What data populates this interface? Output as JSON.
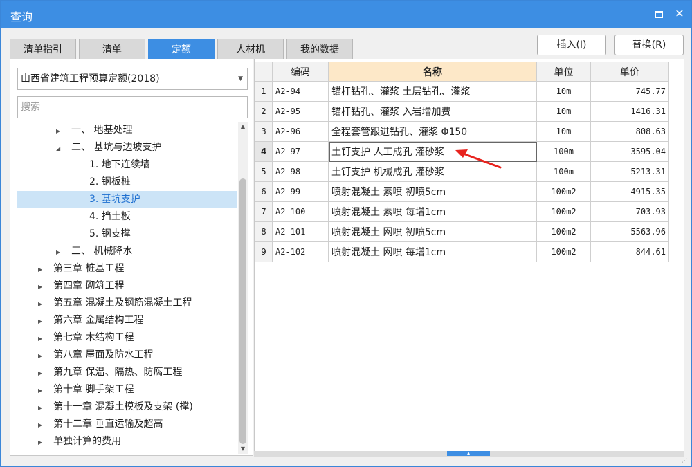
{
  "window": {
    "title": "查询"
  },
  "tabs": [
    {
      "label": "清单指引"
    },
    {
      "label": "清单"
    },
    {
      "label": "定额"
    },
    {
      "label": "人材机"
    },
    {
      "label": "我的数据"
    }
  ],
  "actions": {
    "insert": "插入(I)",
    "replace": "替换(R)"
  },
  "left": {
    "quota_select": "山西省建筑工程预算定额(2018)",
    "search_placeholder": "搜索",
    "tree": [
      {
        "label": "一、 地基处理",
        "arrow": "▶",
        "level": 1
      },
      {
        "label": "二、 基坑与边坡支护",
        "arrow": "◢",
        "level": 1
      },
      {
        "label": "1. 地下连续墙",
        "arrow": "",
        "level": 2
      },
      {
        "label": "2. 钢板桩",
        "arrow": "",
        "level": 2
      },
      {
        "label": "3. 基坑支护",
        "arrow": "",
        "level": 2,
        "selected": true
      },
      {
        "label": "4. 挡土板",
        "arrow": "",
        "level": 2
      },
      {
        "label": "5. 钢支撑",
        "arrow": "",
        "level": 2
      },
      {
        "label": "三、 机械降水",
        "arrow": "▶",
        "level": 1
      },
      {
        "label": "第三章 桩基工程",
        "arrow": "▶",
        "level": 0
      },
      {
        "label": "第四章 砌筑工程",
        "arrow": "▶",
        "level": 0
      },
      {
        "label": "第五章 混凝土及钢筋混凝土工程",
        "arrow": "▶",
        "level": 0
      },
      {
        "label": "第六章 金属结构工程",
        "arrow": "▶",
        "level": 0
      },
      {
        "label": "第七章 木结构工程",
        "arrow": "▶",
        "level": 0
      },
      {
        "label": "第八章 屋面及防水工程",
        "arrow": "▶",
        "level": 0
      },
      {
        "label": "第九章 保温、隔热、防腐工程",
        "arrow": "▶",
        "level": 0
      },
      {
        "label": "第十章 脚手架工程",
        "arrow": "▶",
        "level": 0
      },
      {
        "label": "第十一章 混凝土模板及支架 (撑)",
        "arrow": "▶",
        "level": 0
      },
      {
        "label": "第十二章 垂直运输及超高",
        "arrow": "▶",
        "level": 0
      },
      {
        "label": "单独计算的费用",
        "arrow": "▶",
        "level": 0
      }
    ]
  },
  "grid": {
    "headers": {
      "code": "编码",
      "name": "名称",
      "unit": "单位",
      "price": "单价"
    },
    "rows": [
      {
        "n": "1",
        "code": "A2-94",
        "name": "锚杆钻孔、灌浆 土层钻孔、灌浆",
        "unit": "10m",
        "price": "745.77"
      },
      {
        "n": "2",
        "code": "A2-95",
        "name": "锚杆钻孔、灌浆 入岩增加费",
        "unit": "10m",
        "price": "1416.31"
      },
      {
        "n": "3",
        "code": "A2-96",
        "name": "全程套管跟进钻孔、灌浆 Φ150",
        "unit": "10m",
        "price": "808.63"
      },
      {
        "n": "4",
        "code": "A2-97",
        "name": "土钉支护 人工成孔 灌砂浆",
        "unit": "100m",
        "price": "3595.04",
        "current": true
      },
      {
        "n": "5",
        "code": "A2-98",
        "name": "土钉支护 机械成孔 灌砂浆",
        "unit": "100m",
        "price": "5213.31"
      },
      {
        "n": "6",
        "code": "A2-99",
        "name": "喷射混凝土 素喷 初喷5cm",
        "unit": "100m2",
        "price": "4915.35"
      },
      {
        "n": "7",
        "code": "A2-100",
        "name": "喷射混凝土 素喷 每增1cm",
        "unit": "100m2",
        "price": "703.93"
      },
      {
        "n": "8",
        "code": "A2-101",
        "name": "喷射混凝土 网喷 初喷5cm",
        "unit": "100m2",
        "price": "5563.96"
      },
      {
        "n": "9",
        "code": "A2-102",
        "name": "喷射混凝土 网喷 每增1cm",
        "unit": "100m2",
        "price": "844.61"
      }
    ]
  },
  "colors": {
    "accent": "#3d8ee3",
    "header_highlight": "#fde8c8",
    "selection": "#cce4f7",
    "annotation_arrow": "#e8231e"
  }
}
